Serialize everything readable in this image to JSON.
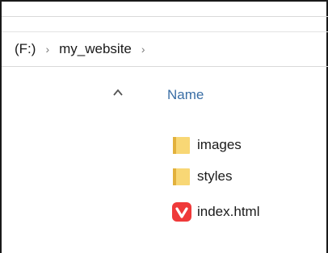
{
  "breadcrumb": {
    "items": [
      "(F:)",
      "my_website"
    ],
    "separator": "›"
  },
  "list": {
    "column_header": "Name",
    "sort_direction": "ascending",
    "files": [
      {
        "name": "images",
        "type": "folder"
      },
      {
        "name": "styles",
        "type": "folder"
      },
      {
        "name": "index.html",
        "type": "html-file"
      }
    ]
  },
  "colors": {
    "folder": "#f8d775",
    "folder_tab": "#e2b13c",
    "vivaldi_red": "#ef3939",
    "header_text": "#3a6ea5"
  }
}
